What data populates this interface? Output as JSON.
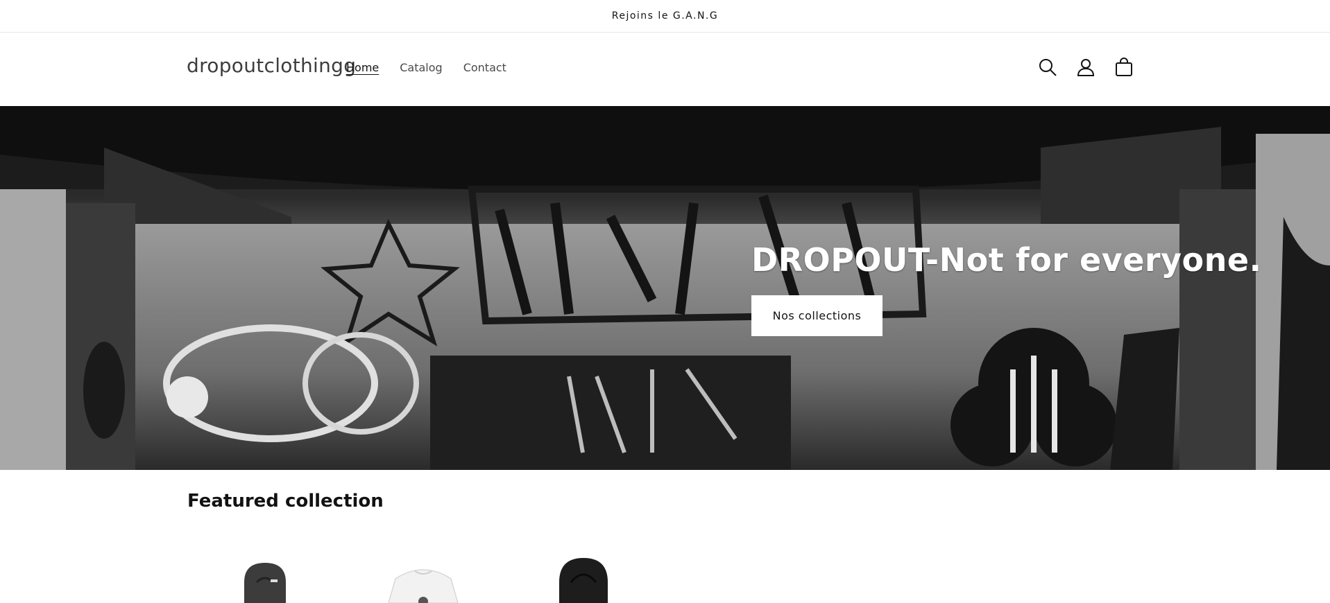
{
  "announcement": {
    "text": "Rejoins le G.A.N.G"
  },
  "header": {
    "logo": "dropoutclothingg",
    "nav": [
      {
        "label": "Home",
        "active": true
      },
      {
        "label": "Catalog",
        "active": false
      },
      {
        "label": "Contact",
        "active": false
      }
    ],
    "icons": [
      "search-icon",
      "account-icon",
      "cart-icon"
    ]
  },
  "hero": {
    "title": "DROPOUT-Not for everyone.",
    "button_label": "Nos collections"
  },
  "featured": {
    "title": "Featured collection",
    "products": [
      {
        "image": "dark-grey-hoodie"
      },
      {
        "image": "white-sweatshirt"
      },
      {
        "image": "black-hoodie"
      }
    ]
  },
  "colors": {
    "text": "#121212",
    "background": "#ffffff",
    "button_bg": "#ffffff"
  }
}
